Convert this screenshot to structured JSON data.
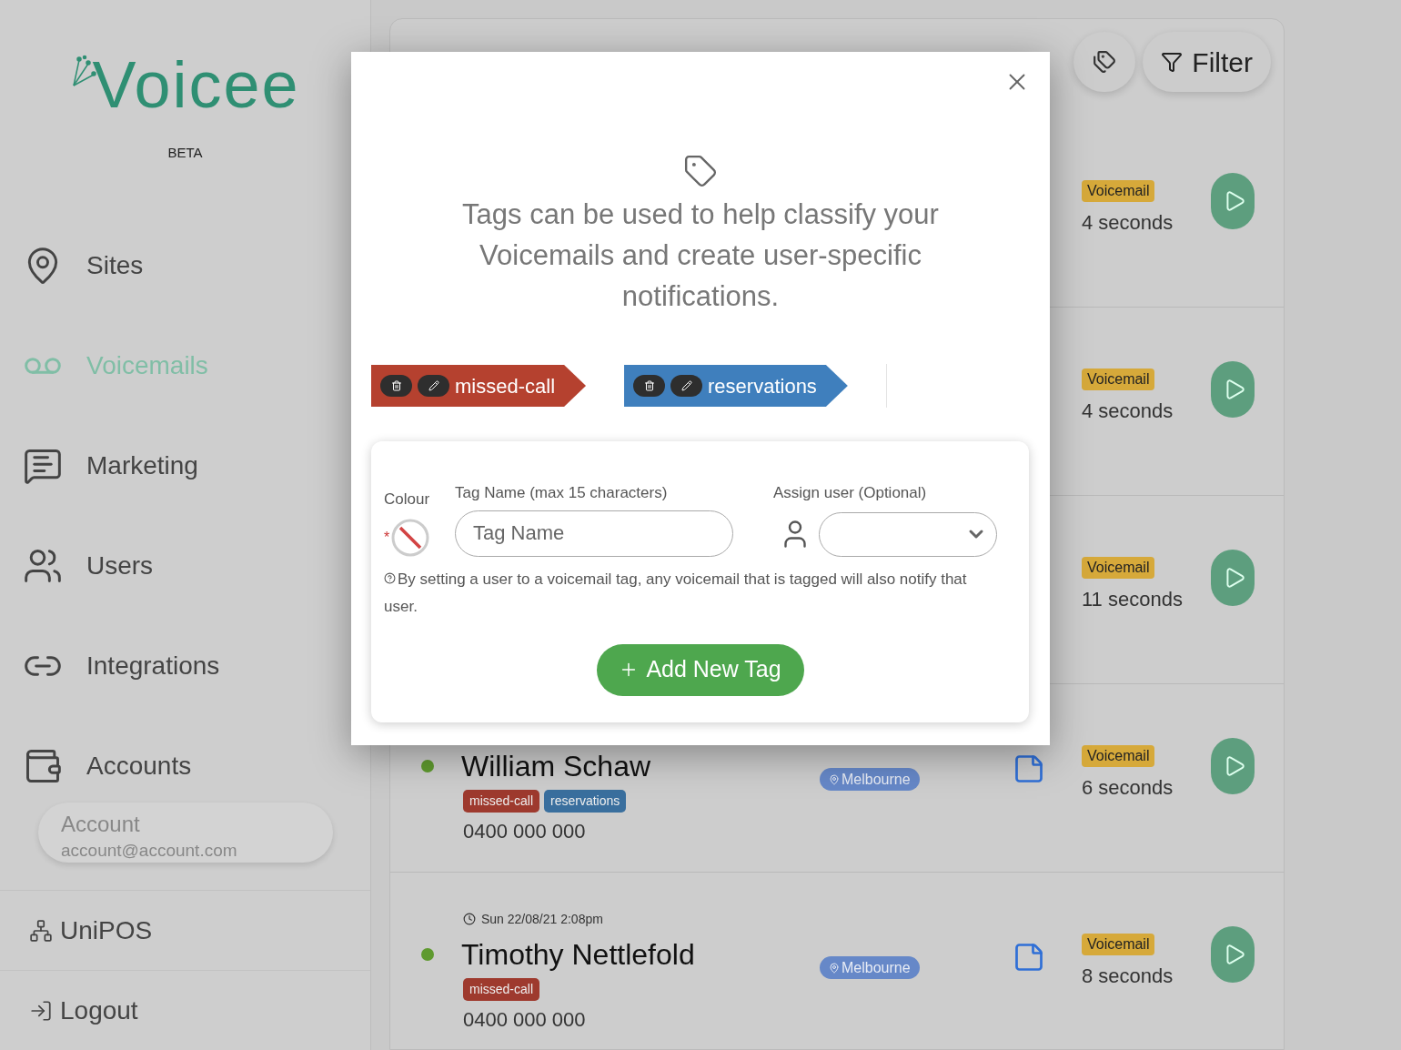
{
  "logo": {
    "wordmark": "Voicee",
    "tagline": "BETA"
  },
  "sidebar": {
    "items": [
      {
        "label": "Sites",
        "selected": false
      },
      {
        "label": "Voicemails",
        "selected": true
      },
      {
        "label": "Marketing",
        "selected": false
      },
      {
        "label": "Users",
        "selected": false
      },
      {
        "label": "Integrations",
        "selected": false
      },
      {
        "label": "Accounts",
        "selected": false
      }
    ],
    "account": {
      "name": "Account",
      "email": "account@account.com"
    },
    "footer": [
      {
        "label": "UniPOS"
      },
      {
        "label": "Logout"
      }
    ]
  },
  "toolbar": {
    "filter_label": "Filter"
  },
  "rows": [
    {
      "badge": "Voicemail",
      "duration": "4 seconds"
    },
    {
      "badge": "Voicemail",
      "duration": "4 seconds"
    },
    {
      "badge": "Voicemail",
      "duration": "11 seconds"
    },
    {
      "name": "William Schaw",
      "tags": [
        {
          "label": "missed-call",
          "color": "#9e3a2e"
        },
        {
          "label": "reservations",
          "color": "#3a6f9e"
        }
      ],
      "phone": "0400 000 000",
      "location": "Melbourne",
      "badge": "Voicemail",
      "duration": "6 seconds"
    },
    {
      "time": "Sun 22/08/21 2:08pm",
      "name": "Timothy Nettlefold",
      "tags": [
        {
          "label": "missed-call",
          "color": "#9e3a2e"
        }
      ],
      "phone": "0400 000 000",
      "location": "Melbourne",
      "badge": "Voicemail",
      "duration": "8 seconds"
    }
  ],
  "modal": {
    "intro": "Tags can be used to help classify your Voicemails and create user-specific notifications.",
    "tags": [
      {
        "label": "missed-call",
        "color": "#b5412f"
      },
      {
        "label": "reservations",
        "color": "#3f7fbd"
      }
    ],
    "form": {
      "colour_label": "Colour",
      "required_mark": "*",
      "name_label": "Tag Name (max 15 characters)",
      "name_placeholder": "Tag Name",
      "assign_label": "Assign user (Optional)",
      "help": "By setting a user to a voicemail tag, any voicemail that is tagged will also notify that user.",
      "submit": "Add New Tag"
    }
  }
}
